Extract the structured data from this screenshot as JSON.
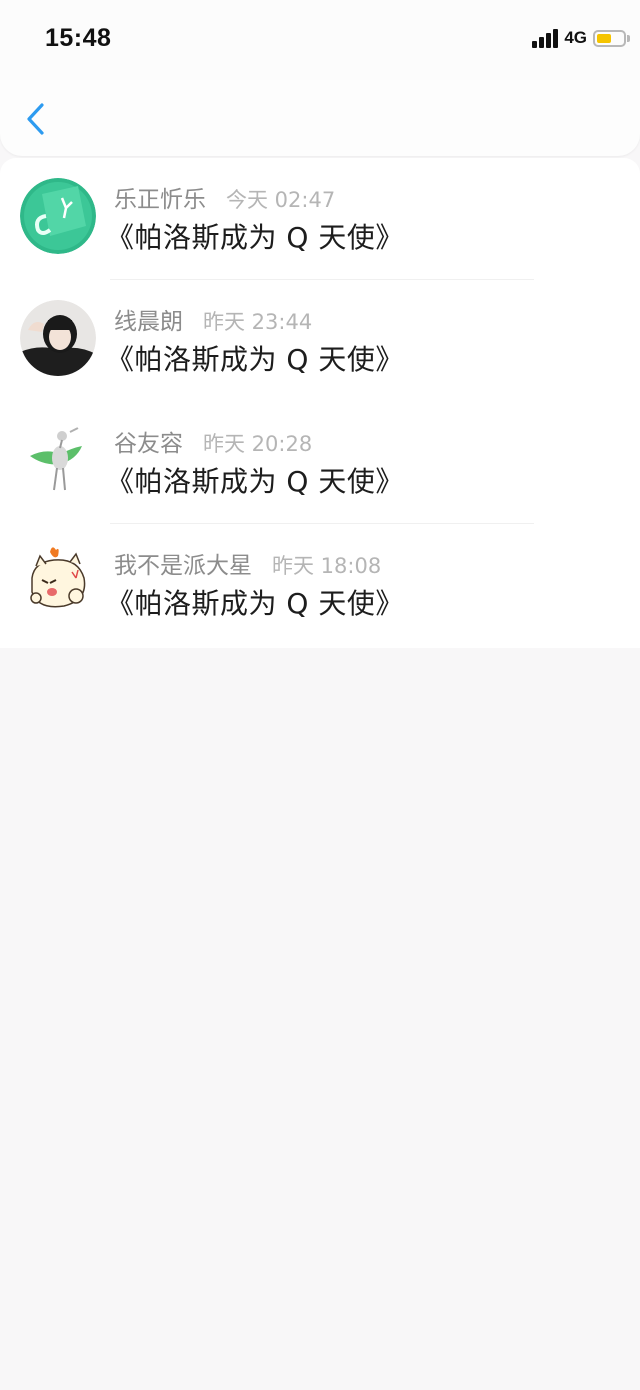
{
  "status_bar": {
    "time": "15:48",
    "network": "4G",
    "signal_icon": "signal-bars-icon",
    "battery_icon": "battery-icon",
    "battery_level": 0.55,
    "battery_color": "#f5c400"
  },
  "nav": {
    "back_icon": "chevron-left-icon",
    "accent_color": "#2d9bf0"
  },
  "messages": [
    {
      "name": "乐正忻乐",
      "time": "今天 02:47",
      "text": "《帕洛斯成为 Q 天使》"
    },
    {
      "name": "线晨朗",
      "time": "昨天 23:44",
      "text": "《帕洛斯成为 Q 天使》"
    },
    {
      "name": "谷友容",
      "time": "昨天 20:28",
      "text": "《帕洛斯成为 Q 天使》"
    },
    {
      "name": "我不是派大星",
      "time": "昨天 18:08",
      "text": "《帕洛斯成为 Q 天使》"
    }
  ]
}
